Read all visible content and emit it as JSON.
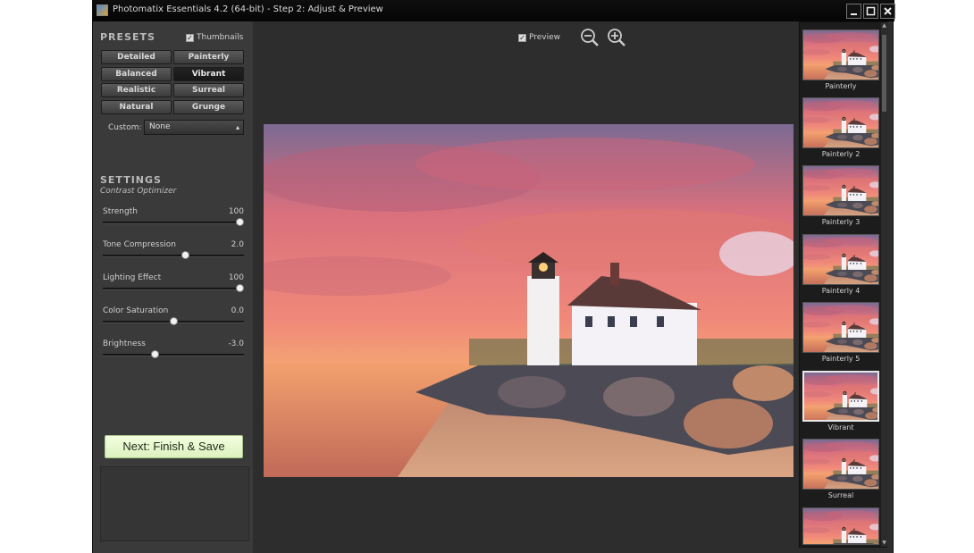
{
  "window": {
    "title": "Photomatix Essentials 4.2 (64-bit) - Step 2: Adjust & Preview",
    "minimize_icon": "minimize-icon",
    "maximize_icon": "maximize-icon",
    "close_icon": "close-icon"
  },
  "presets": {
    "heading": "PRESETS",
    "thumbnails_label": "Thumbnails",
    "thumbnails_checked": true,
    "buttons": [
      {
        "label": "Detailed",
        "active": false
      },
      {
        "label": "Painterly",
        "active": false
      },
      {
        "label": "Balanced",
        "active": false
      },
      {
        "label": "Vibrant",
        "active": true
      },
      {
        "label": "Realistic",
        "active": false
      },
      {
        "label": "Surreal",
        "active": false
      },
      {
        "label": "Natural",
        "active": false
      },
      {
        "label": "Grunge",
        "active": false
      }
    ],
    "custom_label": "Custom:",
    "custom_value": "None"
  },
  "settings": {
    "heading": "SETTINGS",
    "subheading": "Contrast Optimizer",
    "sliders": [
      {
        "label": "Strength",
        "value": "100",
        "position": 1.0
      },
      {
        "label": "Tone Compression",
        "value": "2.0",
        "position": 0.59
      },
      {
        "label": "Lighting Effect",
        "value": "100",
        "position": 1.0
      },
      {
        "label": "Color Saturation",
        "value": "0.0",
        "position": 0.5
      },
      {
        "label": "Brightness",
        "value": "-3.0",
        "position": 0.36
      }
    ]
  },
  "next_button": "Next: Finish & Save",
  "preview": {
    "label": "Preview",
    "checked": true,
    "zoom_out_icon": "zoom-out-icon",
    "zoom_in_icon": "zoom-in-icon"
  },
  "thumbnails": [
    {
      "label": "Painterly",
      "selected": false
    },
    {
      "label": "Painterly 2",
      "selected": false
    },
    {
      "label": "Painterly 3",
      "selected": false
    },
    {
      "label": "Painterly 4",
      "selected": false
    },
    {
      "label": "Painterly 5",
      "selected": false
    },
    {
      "label": "Vibrant",
      "selected": true
    },
    {
      "label": "Surreal",
      "selected": false
    },
    {
      "label": "",
      "selected": false
    }
  ],
  "colors": {
    "background": "#2d2d2d",
    "panel": "#3a3a3a",
    "next_button": "#e6f6cf",
    "sky_pink": "#e8727a",
    "sky_orange": "#f2a25a"
  }
}
